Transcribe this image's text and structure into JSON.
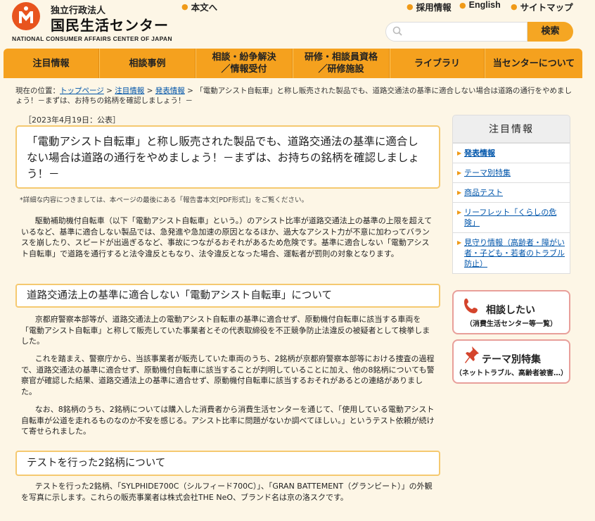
{
  "header": {
    "org_small": "独立行政法人",
    "org_name": "国民生活センター",
    "org_en": "NATIONAL CONSUMER AFFAIRS CENTER OF JAPAN",
    "links": {
      "body_text": "本文へ",
      "procurement": "採用情報",
      "english": "English",
      "sitemap": "サイトマップ"
    },
    "search": {
      "placeholder": "",
      "button": "検索"
    },
    "accent": "#f5a11e"
  },
  "nav": {
    "items": [
      "注目情報",
      "相談事例",
      "相談・紛争解決\n／情報受付",
      "研修・相談員資格\n／研修施設",
      "ライブラリ",
      "当センターについて"
    ]
  },
  "breadcrumb": {
    "prefix": "現在の位置：",
    "top": "トップページ",
    "featured": "注目情報",
    "press": "発表情報",
    "current": "「電動アシスト自転車」と称し販売された製品でも、道路交通法の基準に適合しない場合は道路の通行をやめましょう！－まずは、お持ちの銘柄を確認しましょう！－"
  },
  "article": {
    "date": "［2023年4月19日：公表］",
    "title": "「電動アシスト自転車」と称し販売された製品でも、道路交通法の基準に適合しない場合は道路の通行をやめましょう！－まずは、お持ちの銘柄を確認しましょう！－",
    "note": "*詳細な内容につきましては、本ページの最後にある「報告書本文[PDF形式]」をご覧ください。",
    "intro": "駆動補助機付自転車（以下「電動アシスト自転車」という。）のアシスト比率が道路交通法上の基準の上限を超えているなど、基準に適合しない製品では、急発進や急加速の原因となるほか、過大なアシスト力が不意に加わってバランスを崩したり、スピードが出過ぎるなど、事故につながるおそれがあるため危険です。基準に適合しない「電動アシスト自転車」で道路を通行すると法令違反ともなり、法令違反となった場合、運転者が罰則の対象となります。",
    "h2_1": "道路交通法上の基準に適合しない「電動アシスト自転車」について",
    "p1": "京都府警察本部等が、道路交通法上の電動アシスト自転車の基準に適合せず、原動機付自転車に該当する車両を「電動アシスト自転車」と称して販売していた事業者とその代表取締役を不正競争防止法違反の被疑者として検挙しました。",
    "p2": "これを踏まえ、警察庁から、当該事業者が販売していた車両のうち、2銘柄が京都府警察本部等における捜査の過程で、道路交通法の基準に適合せず、原動機付自転車に該当することが判明していることに加え、他の8銘柄についても警察官が確認した結果、道路交通法上の基準に適合せず、原動機付自転車に該当するおそれがあるとの連絡がありました。",
    "p3": "なお、8銘柄のうち、2銘柄については購入した消費者から消費生活センターを通じて、「使用している電動アシスト自転車が公道を走れるものなのか不安を感じる。アシスト比率に問題がないか調べてほしい。」というテスト依頼が続けて寄せられました。",
    "h2_2": "テストを行った2銘柄について",
    "p4": "テストを行った2銘柄、「SYLPHIDE700C（シルフィード700C）」、「GRAN BATTEMENT（グランビート）」の外観を写真に示します。これらの販売事業者は株式会社THE NeO、ブランド名は京の洛スクです。"
  },
  "sidebar": {
    "title": "注目情報",
    "items": [
      "発表情報",
      "テーマ別特集",
      "商品テスト",
      "リーフレット「くらしの危険」",
      "見守り情報（高齢者・障がい者・子ども・若者のトラブル防止）"
    ],
    "consult_title": "相談したい",
    "consult_sub": "（消費生活センター等一覧）",
    "theme_title": "テーマ別特集",
    "theme_sub": "（ネットトラブル、高齢者被害…）"
  }
}
